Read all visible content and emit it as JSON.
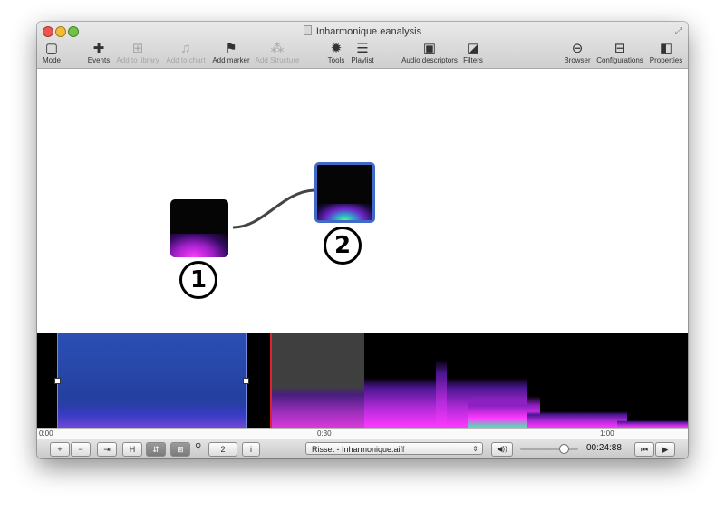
{
  "window": {
    "title": "Inharmonique.eanalysis"
  },
  "toolbar": {
    "items": [
      {
        "label": "Mode",
        "icon": "mode-icon",
        "glyph": "▢",
        "enabled": true
      },
      {
        "label": "Events",
        "icon": "plus-icon",
        "glyph": "✚",
        "enabled": true
      },
      {
        "label": "Add to library",
        "icon": "library-icon",
        "glyph": "⊞",
        "enabled": false
      },
      {
        "label": "Add to chart",
        "icon": "chart-icon",
        "glyph": "♫",
        "enabled": false
      },
      {
        "label": "Add marker",
        "icon": "flag-icon",
        "glyph": "⚑",
        "enabled": true
      },
      {
        "label": "Add Structure",
        "icon": "structure-icon",
        "glyph": "⁂",
        "enabled": false
      },
      {
        "label": "Tools",
        "icon": "gear-icon",
        "glyph": "✹",
        "enabled": true
      },
      {
        "label": "Playlist",
        "icon": "list-icon",
        "glyph": "☰",
        "enabled": true
      },
      {
        "label": "Audio descriptors",
        "icon": "waveform-icon",
        "glyph": "▣",
        "enabled": true
      },
      {
        "label": "Filters",
        "icon": "filter-icon",
        "glyph": "◪",
        "enabled": true
      },
      {
        "label": "Browser",
        "icon": "browser-icon",
        "glyph": "⊖",
        "enabled": true
      },
      {
        "label": "Configurations",
        "icon": "configurations-icon",
        "glyph": "⊟",
        "enabled": true
      },
      {
        "label": "Properties",
        "icon": "properties-icon",
        "glyph": "◧",
        "enabled": true
      }
    ]
  },
  "canvas": {
    "nodes": [
      {
        "number": "1"
      },
      {
        "number": "2"
      }
    ]
  },
  "timeline": {
    "ticks": [
      "0:00",
      "0:30",
      "1:00"
    ]
  },
  "bottombar": {
    "add_label": "+",
    "remove_label": "−",
    "jump_label": "⇥",
    "h_label": "H",
    "toggle1_label": "⇵",
    "toggle2_label": "⊞",
    "zoom_value": "2",
    "info_label": "i",
    "file_select": "Risset - Inharmonique.aiff",
    "volume_label": "◀))",
    "volume_level": 0.75,
    "time": "00:24:88",
    "prev_label": "⏮",
    "play_label": "▶"
  },
  "colors": {
    "selection": "#2b4fb5",
    "playhead": "#e0202a",
    "node_highlight": "#4169c8",
    "spectrogram_energy": "#ff39ff"
  }
}
